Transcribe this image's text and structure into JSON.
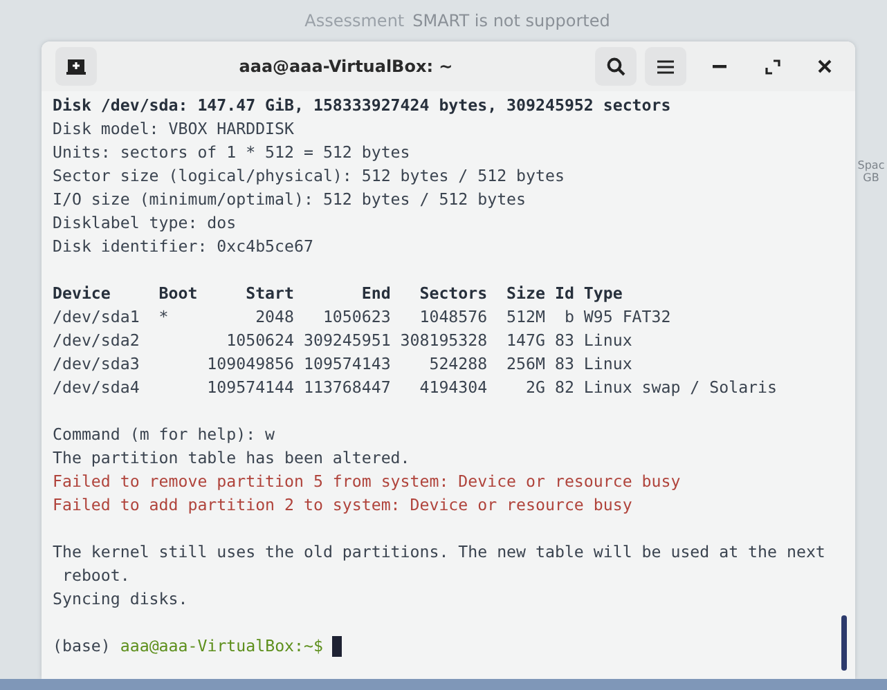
{
  "background": {
    "label": "Assessment",
    "message": "SMART is not supported",
    "side_texts": [
      "Spac",
      "GB"
    ]
  },
  "window": {
    "title": "aaa@aaa-VirtualBox: ~"
  },
  "terminal": {
    "lines": [
      {
        "kind": "bold",
        "text": "Disk /dev/sda: 147.47 GiB, 158333927424 bytes, 309245952 sectors"
      },
      {
        "kind": "normal",
        "text": "Disk model: VBOX HARDDISK"
      },
      {
        "kind": "normal",
        "text": "Units: sectors of 1 * 512 = 512 bytes"
      },
      {
        "kind": "normal",
        "text": "Sector size (logical/physical): 512 bytes / 512 bytes"
      },
      {
        "kind": "normal",
        "text": "I/O size (minimum/optimal): 512 bytes / 512 bytes"
      },
      {
        "kind": "normal",
        "text": "Disklabel type: dos"
      },
      {
        "kind": "normal",
        "text": "Disk identifier: 0xc4b5ce67"
      },
      {
        "kind": "blank"
      },
      {
        "kind": "bold",
        "text": "Device     Boot     Start       End   Sectors  Size Id Type"
      },
      {
        "kind": "normal",
        "text": "/dev/sda1  *         2048   1050623   1048576  512M  b W95 FAT32"
      },
      {
        "kind": "normal",
        "text": "/dev/sda2         1050624 309245951 308195328  147G 83 Linux"
      },
      {
        "kind": "normal",
        "text": "/dev/sda3       109049856 109574143    524288  256M 83 Linux"
      },
      {
        "kind": "normal",
        "text": "/dev/sda4       109574144 113768447   4194304    2G 82 Linux swap / Solaris"
      },
      {
        "kind": "blank"
      },
      {
        "kind": "normal",
        "text": "Command (m for help): w"
      },
      {
        "kind": "normal",
        "text": "The partition table has been altered."
      },
      {
        "kind": "error",
        "text": "Failed to remove partition 5 from system: Device or resource busy"
      },
      {
        "kind": "error",
        "text": "Failed to add partition 2 to system: Device or resource busy"
      },
      {
        "kind": "blank"
      },
      {
        "kind": "normal",
        "text": "The kernel still uses the old partitions. The new table will be used at the next\n reboot."
      },
      {
        "kind": "normal",
        "text": "Syncing disks."
      },
      {
        "kind": "blank"
      },
      {
        "kind": "prompt",
        "prefix": "(base)",
        "text": "aaa@aaa-VirtualBox:~$"
      }
    ]
  }
}
